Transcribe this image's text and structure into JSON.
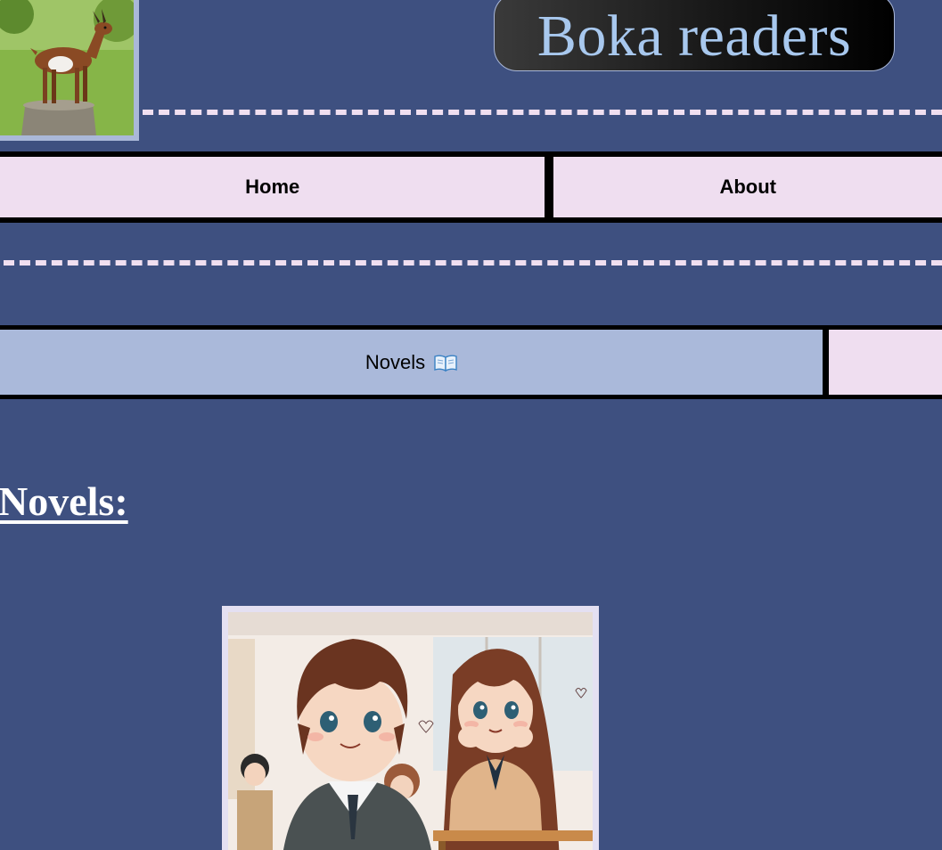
{
  "header": {
    "title": "Boka readers",
    "logo_icon": "goat-logo-icon"
  },
  "nav": {
    "items": [
      {
        "label": "Home"
      },
      {
        "label": "About"
      }
    ]
  },
  "tabs": [
    {
      "label": "Novels",
      "icon": "open-book-icon",
      "active": true
    },
    {
      "label": "",
      "active": false
    }
  ],
  "main": {
    "heading": "Novels:",
    "cover_icon": "anime-novel-cover-image"
  },
  "colors": {
    "background": "#3e5080",
    "nav_bg": "#efdef0",
    "active_tab": "#aab9da",
    "title_text": "#a8c8ee"
  }
}
